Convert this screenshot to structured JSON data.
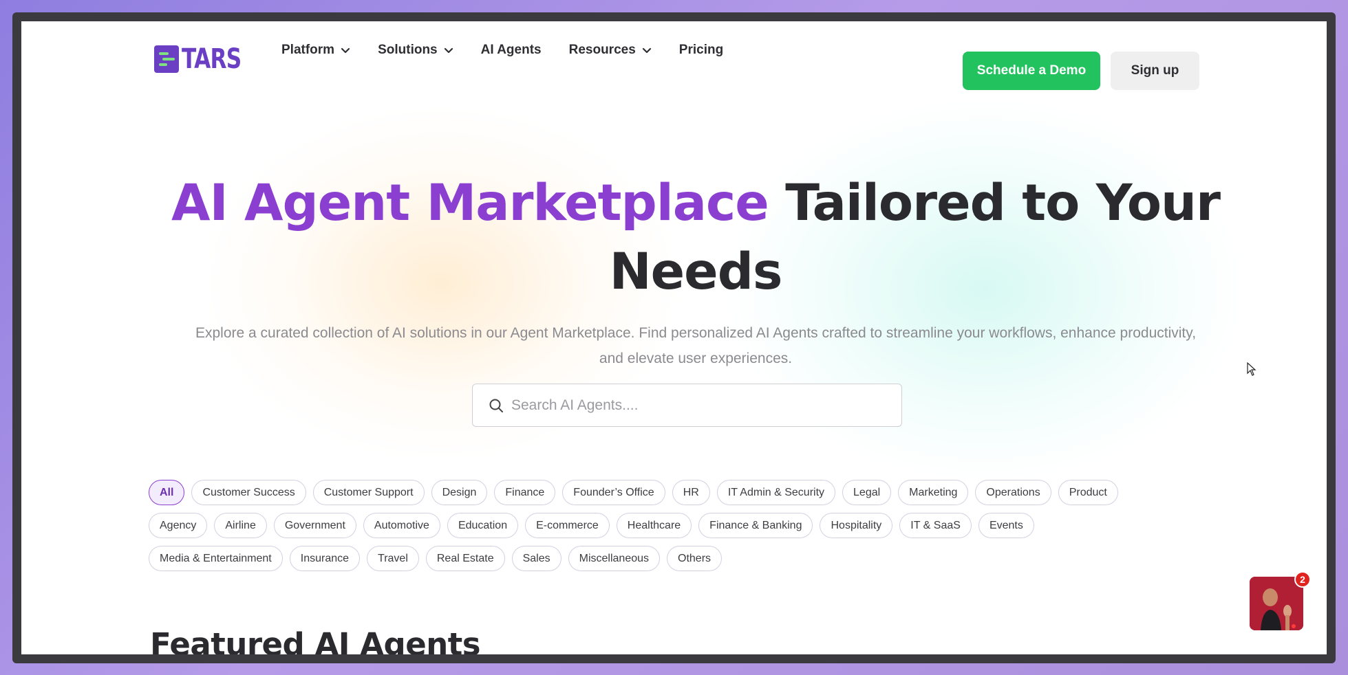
{
  "nav": {
    "logo_text": "TARS",
    "items": [
      {
        "label": "Platform",
        "dropdown": true
      },
      {
        "label": "Solutions",
        "dropdown": true
      },
      {
        "label": "AI Agents",
        "dropdown": false
      },
      {
        "label": "Resources",
        "dropdown": true
      },
      {
        "label": "Pricing",
        "dropdown": false
      }
    ],
    "demo_label": "Schedule a Demo",
    "signup_label": "Sign up"
  },
  "hero": {
    "title_accent": "AI Agent Marketplace",
    "title_rest": "Tailored to Your Needs",
    "subtitle": "Explore a curated collection of AI solutions in our Agent Marketplace. Find personalized AI Agents crafted to streamline your workflows, enhance productivity, and elevate user experiences."
  },
  "search": {
    "placeholder": "Search AI Agents....",
    "value": ""
  },
  "tags": {
    "row1": [
      "All",
      "Customer Success",
      "Customer Support",
      "Design",
      "Finance",
      "Founder’s Office",
      "HR",
      "IT Admin & Security",
      "Legal",
      "Marketing",
      "Operations",
      "Product"
    ],
    "row2": [
      "Agency",
      "Airline",
      "Government",
      "Automotive",
      "Education",
      "E-commerce",
      "Healthcare",
      "Finance & Banking",
      "Hospitality",
      "IT & SaaS",
      "Events"
    ],
    "row3": [
      "Media & Entertainment",
      "Insurance",
      "Travel",
      "Real Estate",
      "Sales",
      "Miscellaneous",
      "Others"
    ],
    "active": "All"
  },
  "featured_heading": "Featured AI Agents",
  "chat_widget": {
    "badge_count": "2"
  },
  "colors": {
    "accent_purple": "#8b3fd1",
    "demo_green": "#22c35e",
    "logo_purple": "#6b3fc4"
  }
}
